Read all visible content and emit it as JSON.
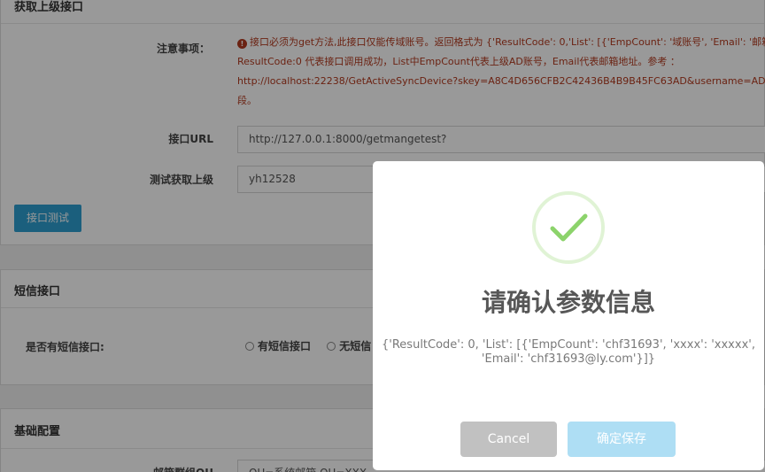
{
  "panel1": {
    "title": "获取上级接口",
    "notice_label": "注意事项：",
    "notice_lines": [
      "接口必须为get方法,此接口仅能传域账号。返回格式为 {'ResultCode': 0,'List': [{'EmpCount': '域账号', 'Email': '邮箱",
      "ResultCode:0 代表接口调用成功，List中EmpCount代表上级AD账号，Email代表邮箱地址。参考 ：",
      "http://localhost:22238/GetActiveSyncDevice?skey=A8C4D656CFB2C42436B4B9B45FC63AD&username=AD账号",
      "段。"
    ],
    "url_label": "接口URL",
    "url_value": "http://127.0.0.1:8000/getmangetest?",
    "test_label": "测试获取上级",
    "test_value": "yh12528",
    "test_button": "接口测试"
  },
  "panel2": {
    "title": "短信接口",
    "sms_label": "是否有短信接口:",
    "options": [
      "有短信接口",
      "无短信"
    ]
  },
  "panel3": {
    "title": "基础配置",
    "ou_label": "邮箱群组OU",
    "ou_value": "OU=系统邮箱,OU=XXX,..."
  },
  "modal": {
    "title": "请确认参数信息",
    "text": "{'ResultCode': 0, 'List': [{'EmpCount': 'chf31693', 'xxxx': 'xxxxx', 'Email': 'chf31693@ly.com'}]}",
    "cancel": "Cancel",
    "confirm": "确定保存",
    "success_color": "#8cd36b"
  }
}
